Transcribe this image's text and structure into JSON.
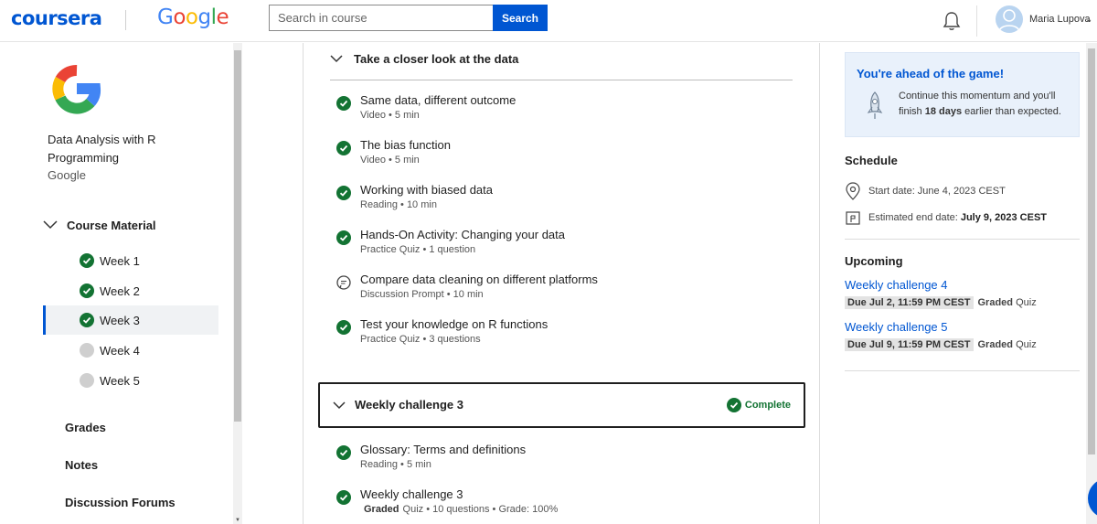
{
  "header": {
    "brand": "coursera",
    "partner": [
      "G",
      "o",
      "o",
      "g",
      "l",
      "e"
    ],
    "partner_colors": [
      "#4285F4",
      "#EA4335",
      "#FBBC05",
      "#4285F4",
      "#34A853",
      "#EA4335"
    ],
    "search_placeholder": "Search in course",
    "search_button": "Search",
    "user_name": "Maria Lupova",
    "user_chevron": "⌄",
    "accent": "#0056d2"
  },
  "sidebar": {
    "course_title": "Data Analysis with R Programming",
    "course_org": "Google",
    "course_material_label": "Course Material",
    "weeks": [
      {
        "label": "Week 1",
        "status": "complete"
      },
      {
        "label": "Week 2",
        "status": "complete"
      },
      {
        "label": "Week 3",
        "status": "complete",
        "active": true
      },
      {
        "label": "Week 4",
        "status": "not-started"
      },
      {
        "label": "Week 5",
        "status": "not-started"
      }
    ],
    "links": [
      "Grades",
      "Notes",
      "Discussion Forums"
    ]
  },
  "main": {
    "section_title": "Take a closer look at the data",
    "items": [
      {
        "title": "Same data, different outcome",
        "meta": "Video • 5 min",
        "icon": "check-circle-icon"
      },
      {
        "title": "The bias function",
        "meta": "Video • 5 min",
        "icon": "check-circle-icon"
      },
      {
        "title": "Working with biased data",
        "meta": "Reading • 10 min",
        "icon": "check-circle-icon"
      },
      {
        "title": "Hands-On Activity: Changing your data",
        "meta": "Practice Quiz • 1 question",
        "icon": "check-circle-icon"
      },
      {
        "title": "Compare data cleaning on different platforms",
        "meta": "Discussion Prompt • 10 min",
        "icon": "discussion-icon"
      },
      {
        "title": "Test your knowledge on R functions",
        "meta": "Practice Quiz • 3 questions",
        "icon": "check-circle-icon"
      }
    ],
    "challenge": {
      "title": "Weekly challenge 3",
      "status": "Complete"
    },
    "challenge_items": [
      {
        "title": "Glossary: Terms and definitions",
        "meta": "Reading • 5 min",
        "graded": ""
      },
      {
        "title": "Weekly challenge 3",
        "meta": "Quiz • 10 questions • Grade: 100%",
        "graded": "Graded"
      }
    ]
  },
  "rail": {
    "ahead_title": "You're ahead of the game!",
    "ahead_text_before": "Continue this momentum and you'll finish ",
    "ahead_days": "18 days",
    "ahead_text_after": " earlier than expected.",
    "schedule_heading": "Schedule",
    "start_date": "Start date: June 4, 2023 CEST",
    "end_label": "Estimated end date: ",
    "end_date": "July 9, 2023 CEST",
    "upcoming_heading": "Upcoming",
    "upcoming": [
      {
        "title": "Weekly challenge 4",
        "due": "Due Jul 2, 11:59 PM CEST",
        "graded": "Graded",
        "type": "Quiz"
      },
      {
        "title": "Weekly challenge 5",
        "due": "Due Jul 9, 11:59 PM CEST",
        "graded": "Graded",
        "type": "Quiz"
      }
    ]
  }
}
